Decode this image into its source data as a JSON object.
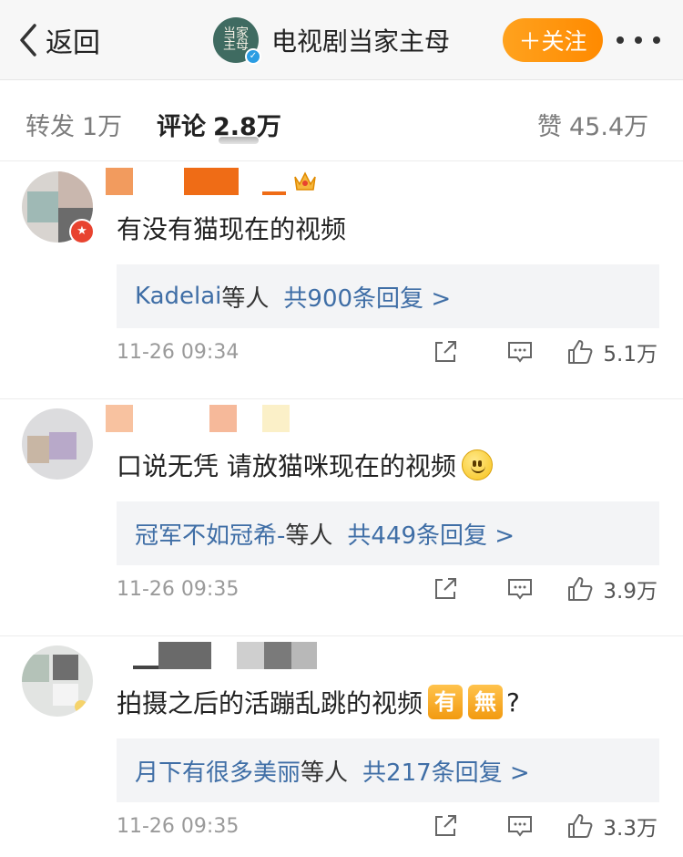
{
  "header": {
    "back_label": "返回",
    "account_name": "电视剧当家主母",
    "avatar_text": "当家主母",
    "follow_label": "＋关注"
  },
  "stats": {
    "repost": {
      "label": "转发",
      "count": "1万"
    },
    "comment": {
      "label": "评论",
      "count": "2.8万"
    },
    "like": {
      "label": "赞",
      "count": "45.4万"
    }
  },
  "comments": [
    {
      "text": "有没有猫现在的视频",
      "reply_users": "Kadelai",
      "reply_and": "等人",
      "reply_total": "共900条回复 >",
      "time": "11-26 09:34",
      "likes": "5.1万"
    },
    {
      "text": "口说无凭 请放猫咪现在的视频",
      "reply_users": "冠军不如冠希-",
      "reply_and": "等人",
      "reply_total": "共449条回复 >",
      "time": "11-26 09:35",
      "likes": "3.9万"
    },
    {
      "text": "拍摄之后的活蹦乱跳的视频",
      "tag1": "有",
      "tag2": "無",
      "tail": "?",
      "reply_users": "月下有很多美丽",
      "reply_and": "等人",
      "reply_total": "共217条回复 >",
      "time": "11-26 09:35",
      "likes": "3.3万"
    }
  ],
  "colors": {
    "follow": "#ff9a12",
    "link": "#3f6ea6",
    "badge": "#e8432f"
  }
}
